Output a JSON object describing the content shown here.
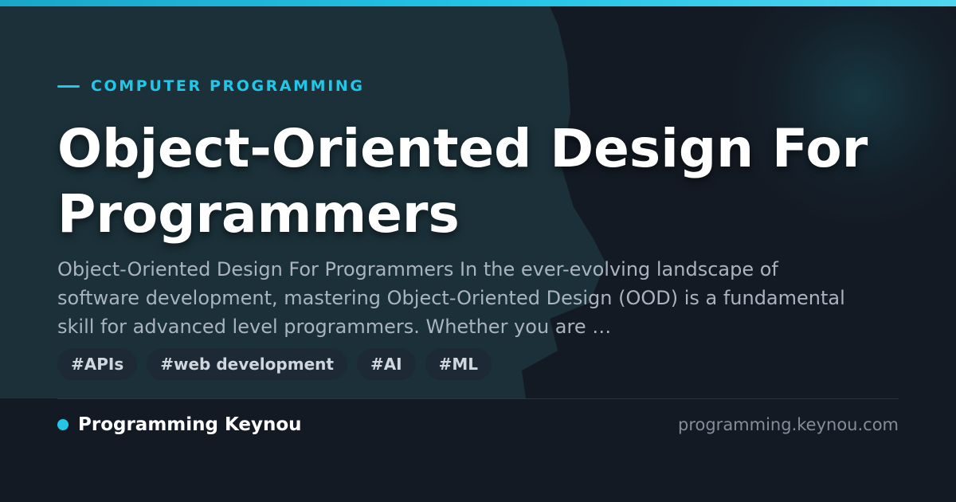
{
  "category": "COMPUTER PROGRAMMING",
  "title": "Object-Oriented Design For Programmers",
  "description": "Object-Oriented Design For Programmers In the ever-evolving landscape of software development, mastering Object-Oriented Design (OOD) is a fundamental skill for advanced level programmers. Whether you are …",
  "tags": [
    "#APIs",
    "#web development",
    "#AI",
    "#ML"
  ],
  "footer": {
    "brand": "Programming Keynou",
    "domain": "programming.keynou.com"
  },
  "colors": {
    "accent": "#22c7e8",
    "background": "#141a24",
    "title": "#ffffff",
    "description": "#aab3c0",
    "tag_background": "#1d2a36",
    "domain": "#838d99"
  }
}
